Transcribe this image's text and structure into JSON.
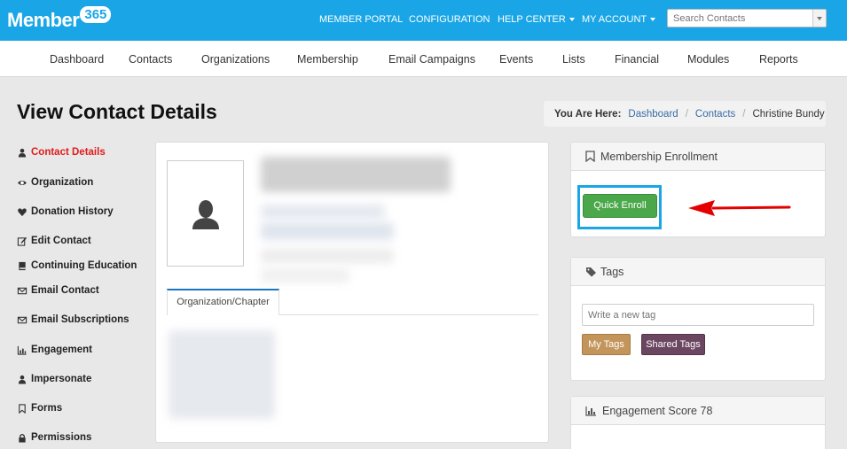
{
  "brand": {
    "name": "Member",
    "badge": "365"
  },
  "topnav": {
    "member_portal": "MEMBER PORTAL",
    "configuration": "CONFIGURATION",
    "help_center": "HELP CENTER",
    "my_account": "MY ACCOUNT"
  },
  "search": {
    "placeholder": "Search Contacts"
  },
  "subnav": [
    "Dashboard",
    "Contacts",
    "Organizations",
    "Membership",
    "Email Campaigns",
    "Events",
    "Lists",
    "Financial",
    "Modules",
    "Reports"
  ],
  "page": {
    "title": "View Contact Details"
  },
  "breadcrumb": {
    "label": "You Are Here:",
    "items": [
      "Dashboard",
      "Contacts"
    ],
    "current": "Christine Bundy"
  },
  "leftmenu": [
    {
      "label": "Contact Details",
      "icon": "user-icon"
    },
    {
      "label": "Organization",
      "icon": "eye-icon"
    },
    {
      "label": "Donation History",
      "icon": "heart-icon"
    },
    {
      "label": "Edit Contact",
      "icon": "edit-icon"
    },
    {
      "label": "Continuing Education",
      "icon": "book-icon"
    },
    {
      "label": "Email Contact",
      "icon": "envelope-icon"
    },
    {
      "label": "Email Subscriptions",
      "icon": "envelope-icon"
    },
    {
      "label": "Engagement",
      "icon": "chart-icon"
    },
    {
      "label": "Impersonate",
      "icon": "user-icon"
    },
    {
      "label": "Forms",
      "icon": "bookmark-icon"
    },
    {
      "label": "Permissions",
      "icon": "lock-icon"
    }
  ],
  "contact": {
    "tab": "Organization/Chapter"
  },
  "membership": {
    "title": "Membership Enrollment",
    "button": "Quick Enroll"
  },
  "tags": {
    "title": "Tags",
    "placeholder": "Write a new tag",
    "my_tags": "My Tags",
    "shared_tags": "Shared Tags"
  },
  "engagement": {
    "title": "Engagement Score 78"
  },
  "colors": {
    "topbar": "#1aa6e6",
    "active": "#e21b1b",
    "enroll": "#4aa84a",
    "my_tags": "#c4955a",
    "shared_tags": "#6b4660",
    "arrow": "#e50000"
  }
}
